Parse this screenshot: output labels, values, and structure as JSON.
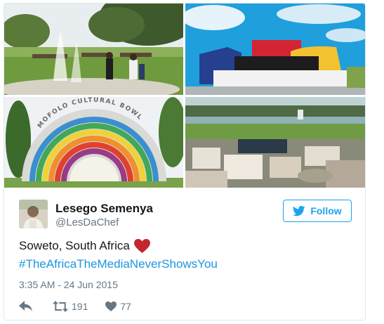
{
  "tweet": {
    "photos": [
      {
        "name": "photo-fountain-park"
      },
      {
        "name": "photo-colorful-building"
      },
      {
        "name": "photo-rainbow-bowl",
        "sign_text": "MOFOLO CULTURAL BOWL"
      },
      {
        "name": "photo-aerial-town"
      }
    ],
    "author": {
      "display_name": "Lesego Semenya",
      "handle": "@LesDaChef",
      "avatar_icon": "user-avatar"
    },
    "follow_label": "Follow",
    "text": "Soweto, South Africa",
    "emoji": "red-heart-icon",
    "hashtag": "#TheAfricaTheMediaNeverShowsYou",
    "timestamp": "3:35 AM - 24 Jun 2015",
    "actions": {
      "reply_icon": "reply-icon",
      "retweet_icon": "retweet-icon",
      "retweet_count": "191",
      "like_icon": "heart-icon",
      "like_count": "77"
    },
    "colors": {
      "accent": "#1da1f2",
      "link": "#1b95e0",
      "muted": "#657786",
      "heart": "#c1272d"
    }
  }
}
